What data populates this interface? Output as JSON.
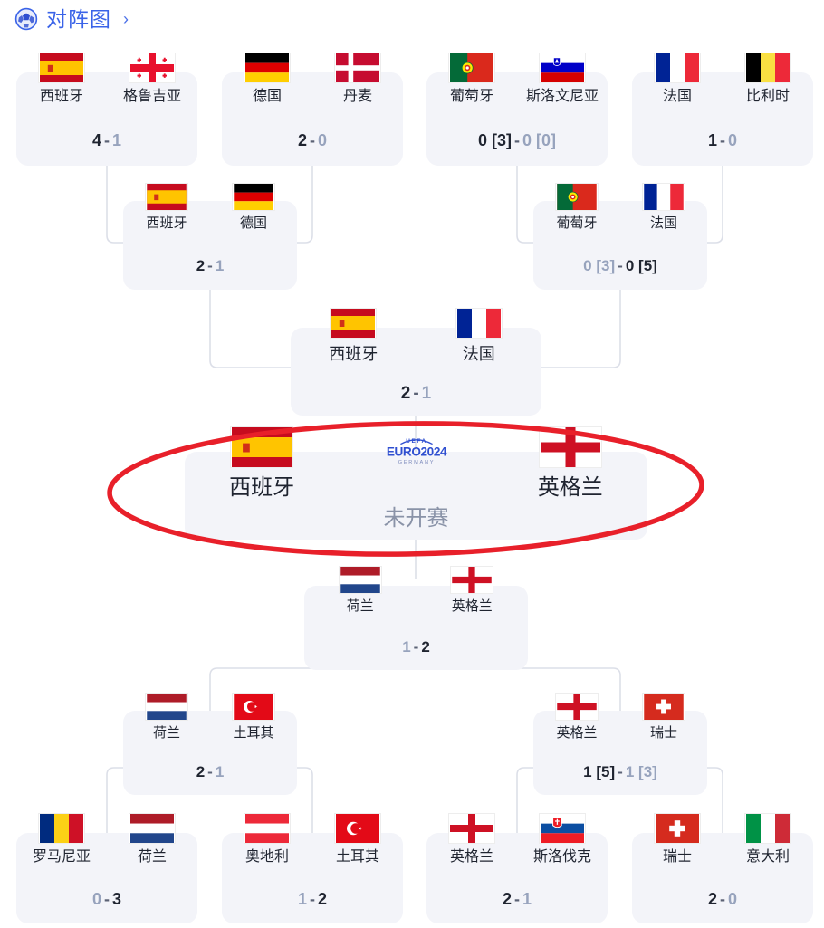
{
  "header": {
    "title": "对阵图",
    "chevron": "›",
    "icon": "soccer-ball-icon",
    "accent_color": "#3a63e8"
  },
  "theme": {
    "card_bg": "#f3f4f9",
    "connector": "#dcdfe8",
    "text": "#1f2430",
    "muted_text": "#97a3bd",
    "highlight_ellipse": "#e8202a"
  },
  "tournament_logo": {
    "top": "UEFA",
    "main": "EURO2024",
    "sub": "GERMANY",
    "color": "#2f4fd0"
  },
  "rounds": {
    "round_of_16_top": [
      {
        "home": {
          "name": "西班牙",
          "flag": "spain",
          "score": "4",
          "winner": true
        },
        "away": {
          "name": "格鲁吉亚",
          "flag": "georgia",
          "score": "1",
          "winner": false
        }
      },
      {
        "home": {
          "name": "德国",
          "flag": "germany",
          "score": "2",
          "winner": true
        },
        "away": {
          "name": "丹麦",
          "flag": "denmark",
          "score": "0",
          "winner": false
        }
      },
      {
        "home": {
          "name": "葡萄牙",
          "flag": "portugal",
          "score": "0",
          "pens": "[3]",
          "winner": true
        },
        "away": {
          "name": "斯洛文尼亚",
          "flag": "slovenia",
          "score": "0",
          "pens": "[0]",
          "winner": false
        }
      },
      {
        "home": {
          "name": "法国",
          "flag": "france",
          "score": "1",
          "winner": true
        },
        "away": {
          "name": "比利时",
          "flag": "belgium",
          "score": "0",
          "winner": false
        }
      }
    ],
    "quarter_finals_top": [
      {
        "home": {
          "name": "西班牙",
          "flag": "spain",
          "score": "2",
          "winner": true
        },
        "away": {
          "name": "德国",
          "flag": "germany",
          "score": "1",
          "winner": false
        }
      },
      {
        "home": {
          "name": "葡萄牙",
          "flag": "portugal",
          "score": "0",
          "pens": "[3]",
          "winner": false
        },
        "away": {
          "name": "法国",
          "flag": "france",
          "score": "0",
          "pens": "[5]",
          "winner": true
        }
      }
    ],
    "semi_final_top": {
      "home": {
        "name": "西班牙",
        "flag": "spain",
        "score": "2",
        "winner": true
      },
      "away": {
        "name": "法国",
        "flag": "france",
        "score": "1",
        "winner": false
      }
    },
    "final": {
      "home": {
        "name": "西班牙",
        "flag": "spain"
      },
      "away": {
        "name": "英格兰",
        "flag": "england"
      },
      "status": "未开赛"
    },
    "semi_final_bottom": {
      "home": {
        "name": "荷兰",
        "flag": "netherlands",
        "score": "1",
        "winner": false
      },
      "away": {
        "name": "英格兰",
        "flag": "england",
        "score": "2",
        "winner": true
      }
    },
    "quarter_finals_bottom": [
      {
        "home": {
          "name": "荷兰",
          "flag": "netherlands",
          "score": "2",
          "winner": true
        },
        "away": {
          "name": "土耳其",
          "flag": "turkey",
          "score": "1",
          "winner": false
        }
      },
      {
        "home": {
          "name": "英格兰",
          "flag": "england",
          "score": "1",
          "pens": "[5]",
          "winner": true
        },
        "away": {
          "name": "瑞士",
          "flag": "switzerland",
          "score": "1",
          "pens": "[3]",
          "winner": false
        }
      }
    ],
    "round_of_16_bottom": [
      {
        "home": {
          "name": "罗马尼亚",
          "flag": "romania",
          "score": "0",
          "winner": false
        },
        "away": {
          "name": "荷兰",
          "flag": "netherlands",
          "score": "3",
          "winner": true
        }
      },
      {
        "home": {
          "name": "奥地利",
          "flag": "austria",
          "score": "1",
          "winner": false
        },
        "away": {
          "name": "土耳其",
          "flag": "turkey",
          "score": "2",
          "winner": true
        }
      },
      {
        "home": {
          "name": "英格兰",
          "flag": "england",
          "score": "2",
          "winner": true
        },
        "away": {
          "name": "斯洛伐克",
          "flag": "slovakia",
          "score": "1",
          "winner": false
        }
      },
      {
        "home": {
          "name": "瑞士",
          "flag": "switzerland",
          "score": "2",
          "winner": true
        },
        "away": {
          "name": "意大利",
          "flag": "italy",
          "score": "0",
          "winner": false
        }
      }
    ]
  }
}
